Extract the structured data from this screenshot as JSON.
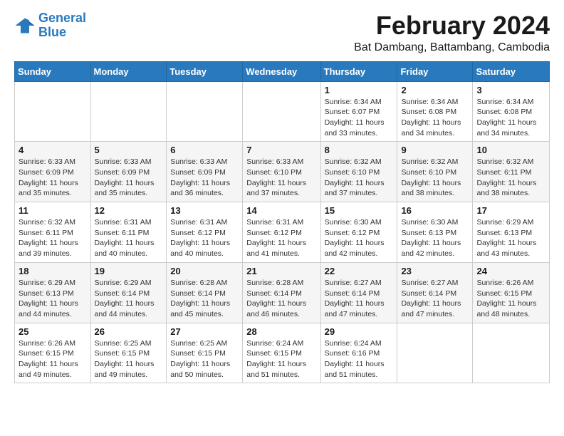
{
  "logo": {
    "line1": "General",
    "line2": "Blue"
  },
  "title": "February 2024",
  "location": "Bat Dambang, Battambang, Cambodia",
  "weekdays": [
    "Sunday",
    "Monday",
    "Tuesday",
    "Wednesday",
    "Thursday",
    "Friday",
    "Saturday"
  ],
  "weeks": [
    [
      {
        "day": "",
        "info": ""
      },
      {
        "day": "",
        "info": ""
      },
      {
        "day": "",
        "info": ""
      },
      {
        "day": "",
        "info": ""
      },
      {
        "day": "1",
        "info": "Sunrise: 6:34 AM\nSunset: 6:07 PM\nDaylight: 11 hours and 33 minutes."
      },
      {
        "day": "2",
        "info": "Sunrise: 6:34 AM\nSunset: 6:08 PM\nDaylight: 11 hours and 34 minutes."
      },
      {
        "day": "3",
        "info": "Sunrise: 6:34 AM\nSunset: 6:08 PM\nDaylight: 11 hours and 34 minutes."
      }
    ],
    [
      {
        "day": "4",
        "info": "Sunrise: 6:33 AM\nSunset: 6:09 PM\nDaylight: 11 hours and 35 minutes."
      },
      {
        "day": "5",
        "info": "Sunrise: 6:33 AM\nSunset: 6:09 PM\nDaylight: 11 hours and 35 minutes."
      },
      {
        "day": "6",
        "info": "Sunrise: 6:33 AM\nSunset: 6:09 PM\nDaylight: 11 hours and 36 minutes."
      },
      {
        "day": "7",
        "info": "Sunrise: 6:33 AM\nSunset: 6:10 PM\nDaylight: 11 hours and 37 minutes."
      },
      {
        "day": "8",
        "info": "Sunrise: 6:32 AM\nSunset: 6:10 PM\nDaylight: 11 hours and 37 minutes."
      },
      {
        "day": "9",
        "info": "Sunrise: 6:32 AM\nSunset: 6:10 PM\nDaylight: 11 hours and 38 minutes."
      },
      {
        "day": "10",
        "info": "Sunrise: 6:32 AM\nSunset: 6:11 PM\nDaylight: 11 hours and 38 minutes."
      }
    ],
    [
      {
        "day": "11",
        "info": "Sunrise: 6:32 AM\nSunset: 6:11 PM\nDaylight: 11 hours and 39 minutes."
      },
      {
        "day": "12",
        "info": "Sunrise: 6:31 AM\nSunset: 6:11 PM\nDaylight: 11 hours and 40 minutes."
      },
      {
        "day": "13",
        "info": "Sunrise: 6:31 AM\nSunset: 6:12 PM\nDaylight: 11 hours and 40 minutes."
      },
      {
        "day": "14",
        "info": "Sunrise: 6:31 AM\nSunset: 6:12 PM\nDaylight: 11 hours and 41 minutes."
      },
      {
        "day": "15",
        "info": "Sunrise: 6:30 AM\nSunset: 6:12 PM\nDaylight: 11 hours and 42 minutes."
      },
      {
        "day": "16",
        "info": "Sunrise: 6:30 AM\nSunset: 6:13 PM\nDaylight: 11 hours and 42 minutes."
      },
      {
        "day": "17",
        "info": "Sunrise: 6:29 AM\nSunset: 6:13 PM\nDaylight: 11 hours and 43 minutes."
      }
    ],
    [
      {
        "day": "18",
        "info": "Sunrise: 6:29 AM\nSunset: 6:13 PM\nDaylight: 11 hours and 44 minutes."
      },
      {
        "day": "19",
        "info": "Sunrise: 6:29 AM\nSunset: 6:14 PM\nDaylight: 11 hours and 44 minutes."
      },
      {
        "day": "20",
        "info": "Sunrise: 6:28 AM\nSunset: 6:14 PM\nDaylight: 11 hours and 45 minutes."
      },
      {
        "day": "21",
        "info": "Sunrise: 6:28 AM\nSunset: 6:14 PM\nDaylight: 11 hours and 46 minutes."
      },
      {
        "day": "22",
        "info": "Sunrise: 6:27 AM\nSunset: 6:14 PM\nDaylight: 11 hours and 47 minutes."
      },
      {
        "day": "23",
        "info": "Sunrise: 6:27 AM\nSunset: 6:14 PM\nDaylight: 11 hours and 47 minutes."
      },
      {
        "day": "24",
        "info": "Sunrise: 6:26 AM\nSunset: 6:15 PM\nDaylight: 11 hours and 48 minutes."
      }
    ],
    [
      {
        "day": "25",
        "info": "Sunrise: 6:26 AM\nSunset: 6:15 PM\nDaylight: 11 hours and 49 minutes."
      },
      {
        "day": "26",
        "info": "Sunrise: 6:25 AM\nSunset: 6:15 PM\nDaylight: 11 hours and 49 minutes."
      },
      {
        "day": "27",
        "info": "Sunrise: 6:25 AM\nSunset: 6:15 PM\nDaylight: 11 hours and 50 minutes."
      },
      {
        "day": "28",
        "info": "Sunrise: 6:24 AM\nSunset: 6:15 PM\nDaylight: 11 hours and 51 minutes."
      },
      {
        "day": "29",
        "info": "Sunrise: 6:24 AM\nSunset: 6:16 PM\nDaylight: 11 hours and 51 minutes."
      },
      {
        "day": "",
        "info": ""
      },
      {
        "day": "",
        "info": ""
      }
    ]
  ]
}
